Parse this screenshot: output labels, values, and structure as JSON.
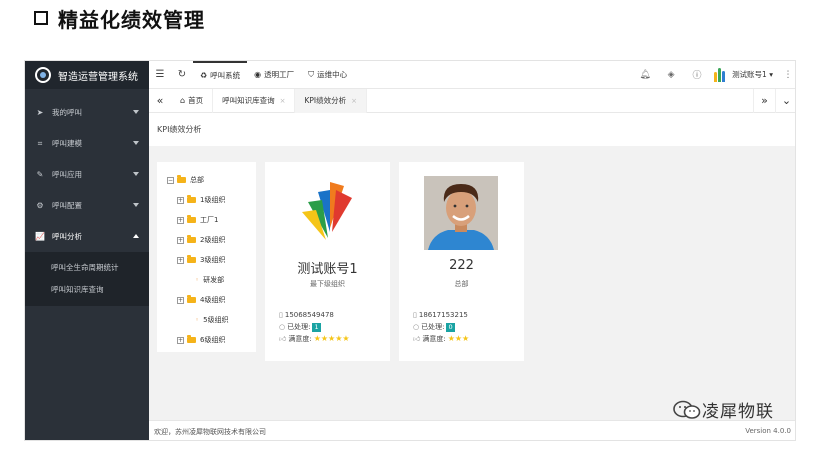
{
  "heading": "精益化绩效管理",
  "app": {
    "brand": "智造运营管理系统",
    "sidebar": {
      "items": [
        {
          "label": "我的呼叫",
          "icon": "paper-plane-icon",
          "open": false
        },
        {
          "label": "呼叫建模",
          "icon": "network-icon",
          "open": false
        },
        {
          "label": "呼叫应用",
          "icon": "wrench-icon",
          "open": false
        },
        {
          "label": "呼叫配置",
          "icon": "gears-icon",
          "open": false
        },
        {
          "label": "呼叫分析",
          "icon": "line-chart-icon",
          "open": true
        }
      ],
      "sub_items": [
        "呼叫全生命周期统计",
        "呼叫知识库查询"
      ]
    },
    "topbar": {
      "links": [
        "呼叫系统",
        "透明工厂",
        "运维中心"
      ],
      "user": "测试账号1"
    },
    "tabs": {
      "home": "首页",
      "items": [
        "呼叫知识库查询",
        "KPI绩效分析"
      ]
    },
    "page_title": "KPI绩效分析",
    "tree": [
      {
        "label": "总部",
        "level": 0,
        "type": "folder",
        "toggle": "−"
      },
      {
        "label": "1级组织",
        "level": 1,
        "type": "folder",
        "toggle": "+"
      },
      {
        "label": "工厂1",
        "level": 1,
        "type": "folder",
        "toggle": "+"
      },
      {
        "label": "2级组织",
        "level": 1,
        "type": "folder",
        "toggle": "+"
      },
      {
        "label": "3级组织",
        "level": 1,
        "type": "folder",
        "toggle": "+"
      },
      {
        "label": "研发部",
        "level": 2,
        "type": "leaf",
        "toggle": ""
      },
      {
        "label": "4级组织",
        "level": 1,
        "type": "folder",
        "toggle": "+"
      },
      {
        "label": "5级组织",
        "level": 2,
        "type": "leaf",
        "toggle": ""
      },
      {
        "label": "6级组织",
        "level": 1,
        "type": "folder",
        "toggle": "+"
      }
    ],
    "cards": [
      {
        "name": "测试账号1",
        "org": "最下级组织",
        "phone": "15068549478",
        "processed_label": "已处理:",
        "processed": "1",
        "satisfaction_label": "满意度:",
        "stars": "★★★★★",
        "picture": "logo"
      },
      {
        "name": "222",
        "org": "总部",
        "phone": "18617153215",
        "processed_label": "已处理:",
        "processed": "0",
        "satisfaction_label": "满意度:",
        "stars": "★★★",
        "picture": "photo"
      }
    ],
    "footer": "欢迎，苏州凌犀物联网技术有限公司",
    "version": "Version 4.0.0"
  },
  "watermark": "凌犀物联"
}
